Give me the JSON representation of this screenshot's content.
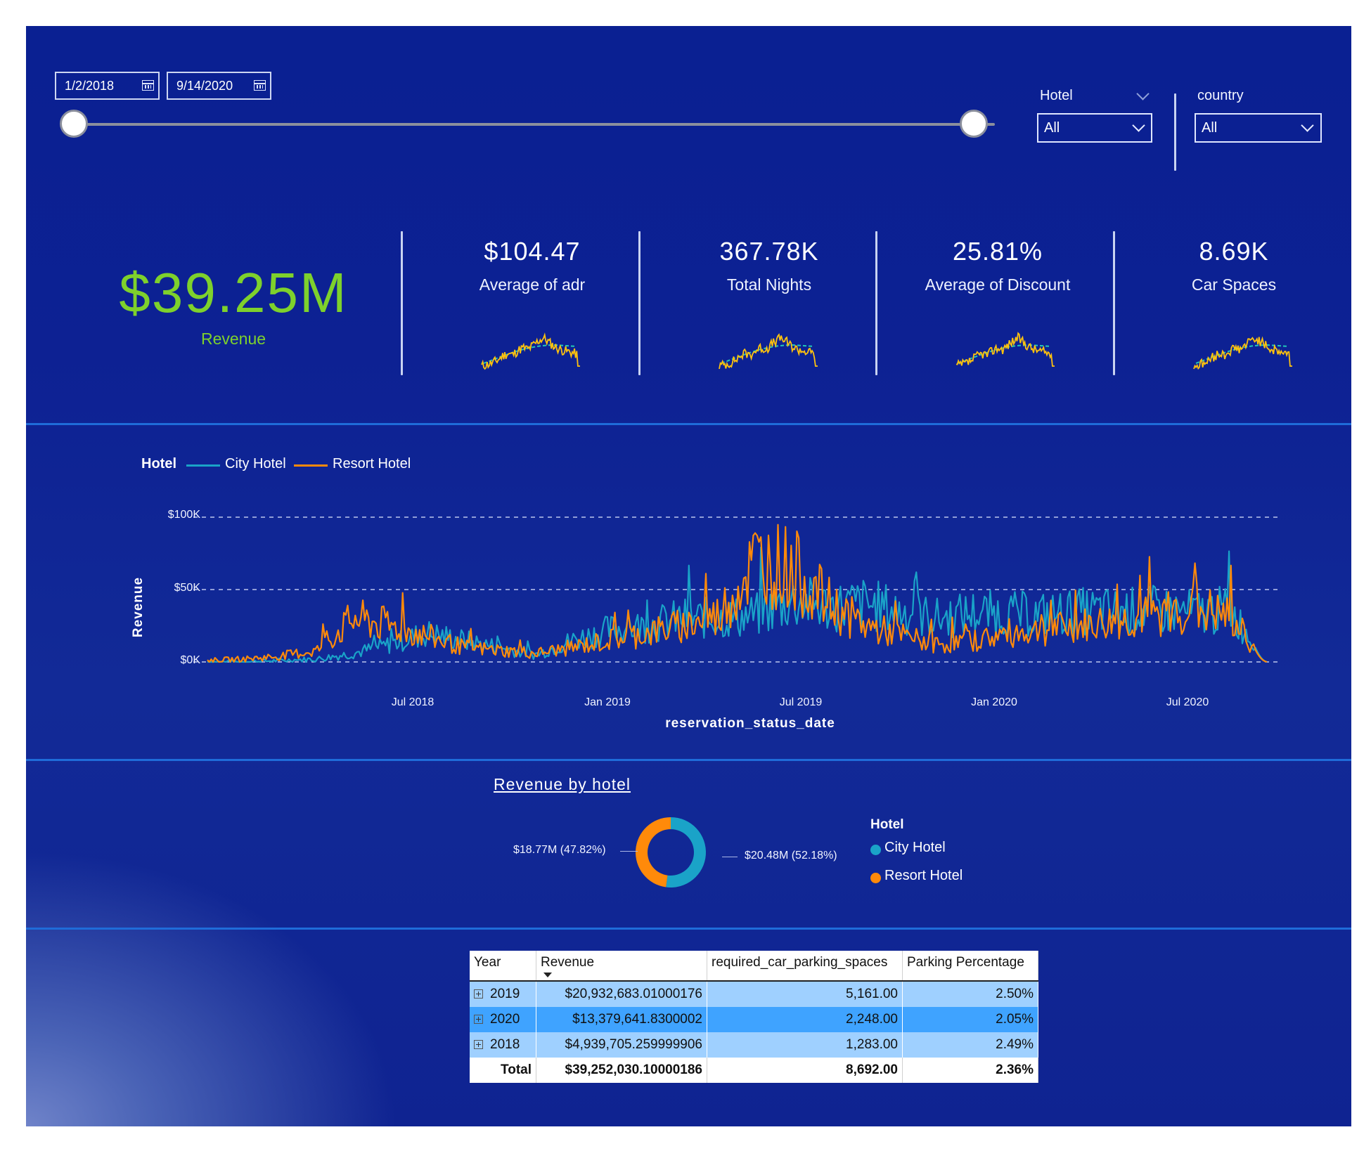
{
  "slicer": {
    "start_date": "1/2/2018",
    "end_date": "9/14/2020"
  },
  "filters": {
    "hotel": {
      "label": "Hotel",
      "value": "All"
    },
    "country": {
      "label": "country",
      "value": "All"
    }
  },
  "kpis": {
    "revenue": {
      "value": "$39.25M",
      "label": "Revenue"
    },
    "cards": [
      {
        "value": "$104.47",
        "label": "Average of adr"
      },
      {
        "value": "367.78K",
        "label": "Total Nights"
      },
      {
        "value": "25.81%",
        "label": "Average of Discount"
      },
      {
        "value": "8.69K",
        "label": "Car Spaces"
      }
    ]
  },
  "line_chart": {
    "legend_title": "Hotel",
    "series_names": [
      "City Hotel",
      "Resort Hotel"
    ],
    "ylabel": "Revenue",
    "xlabel": "reservation_status_date",
    "yticks": [
      "$100K",
      "$50K",
      "$0K"
    ],
    "xticks": [
      "Jul 2018",
      "Jan 2019",
      "Jul 2019",
      "Jan 2020",
      "Jul 2020"
    ]
  },
  "donut": {
    "title": "Revenue by hotel",
    "legend_title": "Hotel",
    "legend": [
      "City Hotel",
      "Resort Hotel"
    ],
    "label_resort": "$18.77M (47.82%)",
    "label_city": "$20.48M (52.18%)"
  },
  "table": {
    "headers": [
      "Year",
      "Revenue",
      "required_car_parking_spaces",
      "Parking Percentage"
    ],
    "rows": [
      [
        "2019",
        "$20,932,683.01000176",
        "5,161.00",
        "2.50%"
      ],
      [
        "2020",
        "$13,379,641.8300002",
        "2,248.00",
        "2.05%"
      ],
      [
        "2018",
        "$4,939,705.259999906",
        "1,283.00",
        "2.49%"
      ]
    ],
    "total": [
      "Total",
      "$39,252,030.10000186",
      "8,692.00",
      "2.36%"
    ]
  },
  "colors": {
    "city_hotel": "#1aa3c8",
    "resort_hotel": "#ff8a0a",
    "revenue_green": "#7ed12c",
    "spark_yellow": "#ffc20e",
    "spark_trend": "#22c7b8"
  },
  "chart_data": [
    {
      "type": "line",
      "title": "",
      "xlabel": "reservation_status_date",
      "ylabel": "Revenue",
      "ylim": [
        0,
        100000
      ],
      "x": [
        "2018-01",
        "2018-03",
        "2018-05",
        "2018-07",
        "2018-08",
        "2018-09",
        "2018-10",
        "2018-11",
        "2018-12",
        "2019-01",
        "2019-02",
        "2019-03",
        "2019-04",
        "2019-05",
        "2019-06",
        "2019-07",
        "2019-08",
        "2019-09",
        "2019-10",
        "2019-11",
        "2019-12",
        "2020-01",
        "2020-02",
        "2020-03",
        "2020-04",
        "2020-05",
        "2020-06",
        "2020-07",
        "2020-08",
        "2020-09"
      ],
      "series": [
        {
          "name": "City Hotel",
          "values": [
            0,
            0,
            1000,
            2000,
            6000,
            12000,
            20000,
            15000,
            10000,
            5000,
            15000,
            22000,
            25000,
            30000,
            30000,
            32000,
            42000,
            38000,
            40000,
            35000,
            30000,
            34000,
            33000,
            33000,
            35000,
            35000,
            36000,
            34000,
            36000,
            0
          ]
        },
        {
          "name": "Resort Hotel",
          "values": [
            1000,
            2000,
            4000,
            8000,
            30000,
            25000,
            18000,
            10000,
            8000,
            6000,
            10000,
            15000,
            20000,
            25000,
            32000,
            70000,
            65000,
            40000,
            25000,
            18000,
            12000,
            15000,
            20000,
            22000,
            25000,
            28000,
            32000,
            38000,
            30000,
            0
          ]
        }
      ]
    },
    {
      "type": "pie",
      "title": "Revenue by hotel",
      "categories": [
        "City Hotel",
        "Resort Hotel"
      ],
      "values": [
        20.48,
        18.77
      ]
    }
  ]
}
